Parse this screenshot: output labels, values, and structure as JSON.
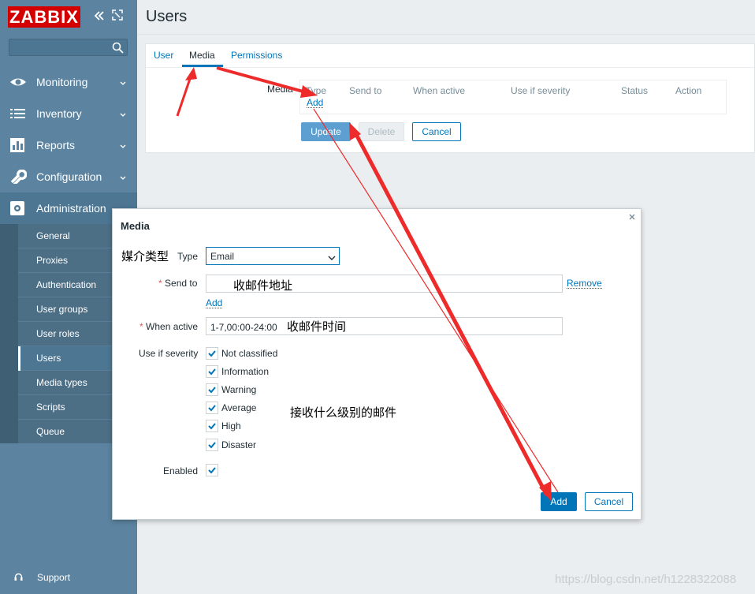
{
  "app": {
    "logo": "ZABBIX"
  },
  "sidebar": {
    "search_placeholder": "",
    "menu": [
      {
        "label": "Monitoring",
        "icon": "eye-icon"
      },
      {
        "label": "Inventory",
        "icon": "list-icon"
      },
      {
        "label": "Reports",
        "icon": "bar-chart-icon"
      },
      {
        "label": "Configuration",
        "icon": "wrench-icon"
      },
      {
        "label": "Administration",
        "icon": "gear-icon"
      }
    ],
    "submenu": [
      "General",
      "Proxies",
      "Authentication",
      "User groups",
      "User roles",
      "Users",
      "Media types",
      "Scripts",
      "Queue"
    ],
    "support": "Support"
  },
  "page": {
    "title": "Users",
    "tabs": [
      "User",
      "Media",
      "Permissions"
    ],
    "media_label": "Media",
    "table_headers": [
      "Type",
      "Send to",
      "When active",
      "Use if severity",
      "Status",
      "Action"
    ],
    "add_link": "Add",
    "buttons": {
      "update": "Update",
      "delete": "Delete",
      "cancel": "Cancel"
    }
  },
  "modal": {
    "title": "Media",
    "type_label": "Type",
    "type_value": "Email",
    "send_to_label": "Send to",
    "send_to_value": "",
    "remove_link": "Remove",
    "add_link": "Add",
    "when_active_label": "When active",
    "when_active_value": "1-7,00:00-24:00",
    "severity_label": "Use if severity",
    "severities": [
      "Not classified",
      "Information",
      "Warning",
      "Average",
      "High",
      "Disaster"
    ],
    "enabled_label": "Enabled",
    "buttons": {
      "add": "Add",
      "cancel": "Cancel"
    }
  },
  "annotations": {
    "type": "媒介类型",
    "send_to": "收邮件地址",
    "when_active": "收邮件时间",
    "severity": "接收什么级别的邮件"
  },
  "watermark": "https://blog.csdn.net/h1228322088",
  "colors": {
    "sidebar": "#5c84a0",
    "accent": "#0275b8",
    "logo": "#d40000",
    "arrow": "#ee2b2b"
  }
}
